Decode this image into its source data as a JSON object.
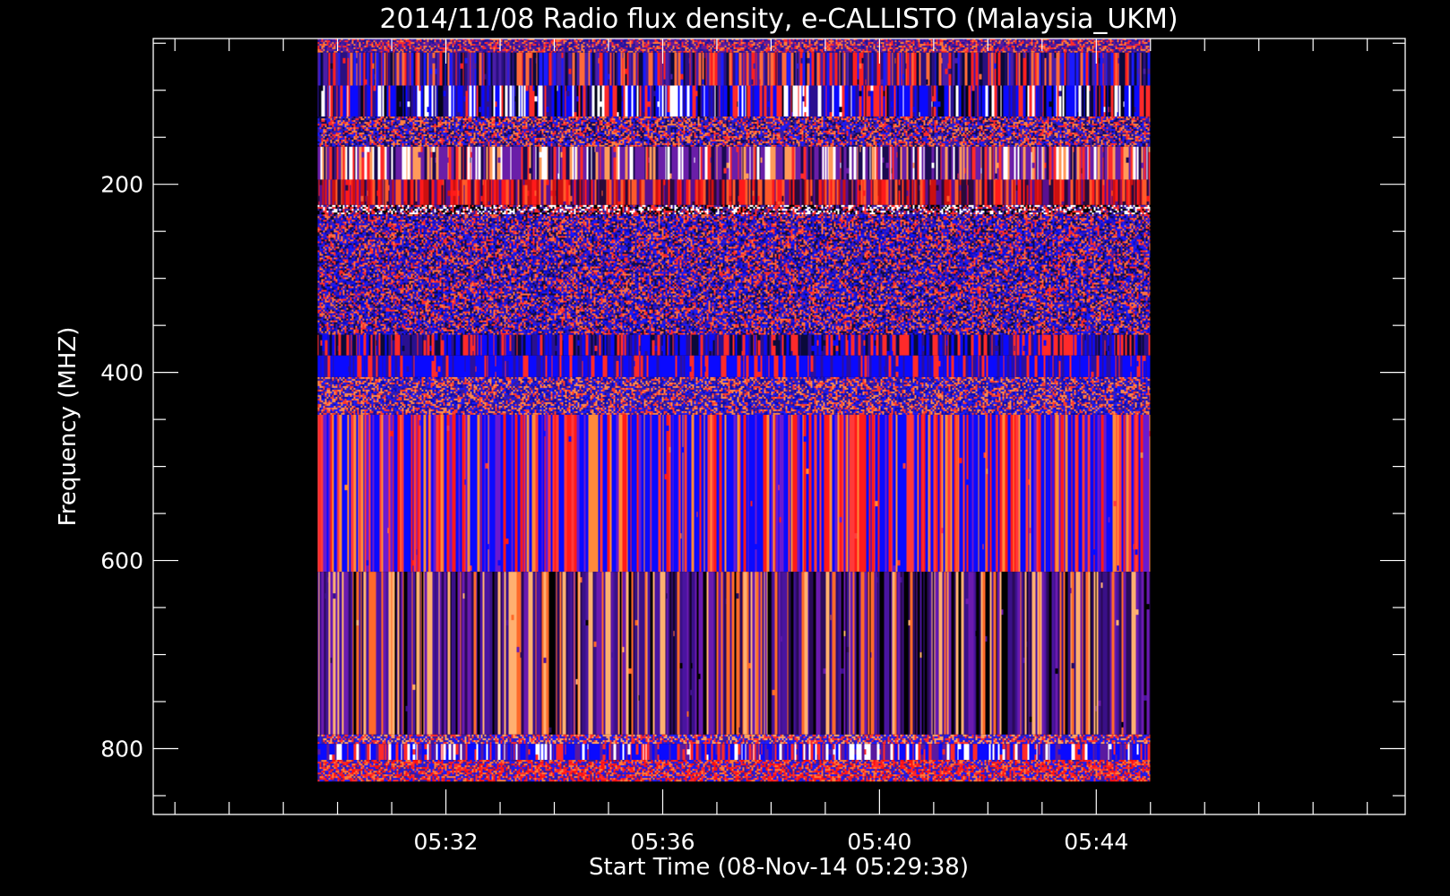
{
  "chart_data": {
    "type": "heatmap",
    "title": "2014/11/08  Radio flux density, e-CALLISTO (Malaysia_UKM)",
    "xlabel": "Start Time (08-Nov-14 05:29:38)",
    "ylabel": "Frequency (MHZ)",
    "x_start": "05:29:38",
    "x_end": "05:45:00",
    "xlim": [
      "05:26:36",
      "05:49:42"
    ],
    "x_ticks": [
      "05:32",
      "05:36",
      "05:40",
      "05:44"
    ],
    "x_minor_tick_step_minutes": 1,
    "y_start": 45,
    "y_end": 835,
    "ylim": [
      45,
      870
    ],
    "y_inverted": true,
    "y_ticks": [
      200,
      400,
      600,
      800
    ],
    "y_minor_tick_step": 50,
    "grid": false,
    "bands": [
      {
        "from": 45,
        "to": 60,
        "texture": "speckle",
        "colors": [
          "#ff2a2a",
          "#3a1aa0",
          "#ff7a3a",
          "#1a10a0",
          "#6a1a9a"
        ]
      },
      {
        "from": 60,
        "to": 95,
        "texture": "stripes",
        "colors": [
          "#4a1ea8",
          "#ff2020",
          "#1a1aff",
          "#2a1080",
          "#ff6a3a",
          "#0a0a3a"
        ]
      },
      {
        "from": 95,
        "to": 128,
        "texture": "stripes",
        "colors": [
          "#0a0aff",
          "#0a0aff",
          "#2a1090",
          "#ff2a2a",
          "#ffffff",
          "#05051a"
        ]
      },
      {
        "from": 128,
        "to": 160,
        "texture": "speckle",
        "colors": [
          "#3a1aa0",
          "#ff2a2a",
          "#1a1aff",
          "#ff8040",
          "#10085a"
        ]
      },
      {
        "from": 160,
        "to": 195,
        "texture": "stripes",
        "colors": [
          "#6a1ea8",
          "#6a1ea8",
          "#ff2a2a",
          "#ff9a5a",
          "#1a0a50",
          "#ffffff"
        ]
      },
      {
        "from": 195,
        "to": 222,
        "texture": "stripes",
        "colors": [
          "#ff1a1a",
          "#cc1010",
          "#5a1090",
          "#2a0a3a",
          "#ff5a2a"
        ]
      },
      {
        "from": 222,
        "to": 232,
        "texture": "speckle",
        "colors": [
          "#000000",
          "#3a1aa0",
          "#ff2a2a",
          "#ffffff"
        ]
      },
      {
        "from": 232,
        "to": 360,
        "texture": "speckle",
        "colors": [
          "#1a1aff",
          "#ff2a2a",
          "#3a1ab0",
          "#0a0ad0",
          "#ff7040",
          "#120a40"
        ]
      },
      {
        "from": 360,
        "to": 382,
        "texture": "stripes",
        "colors": [
          "#0a0aff",
          "#ff2a2a",
          "#2a1090",
          "#0a0a3a"
        ]
      },
      {
        "from": 382,
        "to": 405,
        "texture": "stripes",
        "colors": [
          "#0a0aff",
          "#0a0aff",
          "#0a0aff",
          "#ff2a2a",
          "#2a10a0"
        ]
      },
      {
        "from": 405,
        "to": 445,
        "texture": "speckle",
        "colors": [
          "#1a1aff",
          "#ff3a2a",
          "#3a1aa0",
          "#ff8a4a",
          "#0a0ab0"
        ]
      },
      {
        "from": 445,
        "to": 612,
        "texture": "stripes",
        "colors": [
          "#0a0aff",
          "#0a0aff",
          "#0a0aff",
          "#ff1a1a",
          "#ff3a3a",
          "#6a1ad0",
          "#ff8a3a"
        ]
      },
      {
        "from": 612,
        "to": 785,
        "texture": "stripes",
        "colors": [
          "#3a1088",
          "#4a14a0",
          "#2a0a5a",
          "#6a1ab0",
          "#000000",
          "#ff6a2a",
          "#ffb070"
        ]
      },
      {
        "from": 785,
        "to": 795,
        "texture": "speckle",
        "colors": [
          "#ff2a2a",
          "#3a1aa0",
          "#ffa060",
          "#1a1aff"
        ]
      },
      {
        "from": 795,
        "to": 812,
        "texture": "stripes",
        "colors": [
          "#0a0aff",
          "#0a0aff",
          "#ff2a2a",
          "#5a1aa0",
          "#ffffff"
        ]
      },
      {
        "from": 812,
        "to": 835,
        "texture": "speckle",
        "colors": [
          "#ff2a2a",
          "#1a1aff",
          "#ff7a3a",
          "#3a1aa0",
          "#ff1010"
        ]
      }
    ]
  },
  "colors": {
    "background": "#000000",
    "foreground": "#ffffff"
  }
}
